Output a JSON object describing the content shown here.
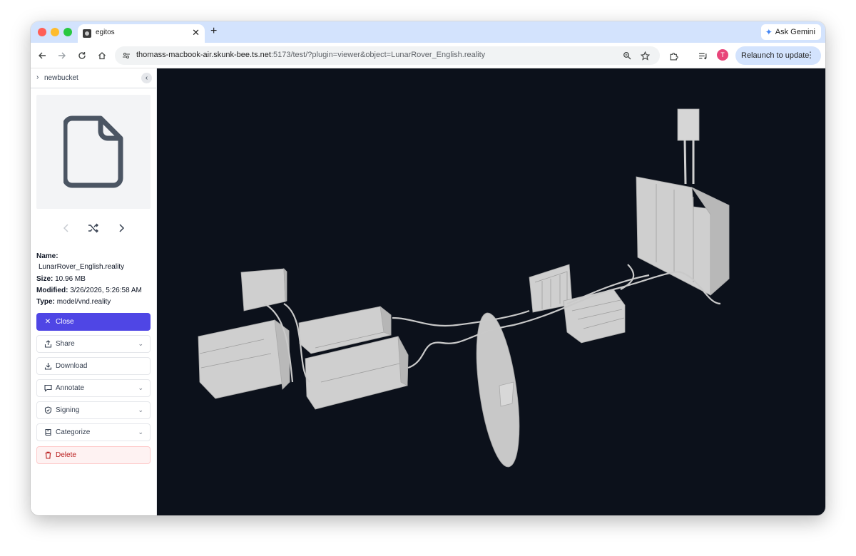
{
  "browser": {
    "tab_title": "egitos",
    "tab_close": "✕",
    "new_tab": "+",
    "gemini_label": "Ask Gemini",
    "url_host": "thomass-macbook-air.skunk-bee.ts.net",
    "url_path": ":5173/test/?plugin=viewer&object=LunarRover_English.reality",
    "avatar_initial": "T",
    "relaunch_label": "Relaunch to update"
  },
  "sidebar": {
    "breadcrumb": "newbucket",
    "name_label": "Name:",
    "name_value": "LunarRover_English.reality",
    "size_label": "Size:",
    "size_value": "10.96 MB",
    "modified_label": "Modified:",
    "modified_value": "3/26/2026, 5:26:58 AM",
    "type_label": "Type:",
    "type_value": "model/vnd.reality",
    "buttons": {
      "close": "Close",
      "share": "Share",
      "download": "Download",
      "annotate": "Annotate",
      "signing": "Signing",
      "categorize": "Categorize",
      "delete": "Delete"
    }
  },
  "colors": {
    "tabstrip": "#d3e3fd",
    "primary": "#4f46e5",
    "danger": "#b91c1c",
    "viewer_bg": "#0c111b",
    "model_gray": "#cfcfcf"
  },
  "icons": {
    "file": "file-icon",
    "shuffle": "shuffle-icon",
    "prev": "chevron-left-icon",
    "next": "chevron-right-icon"
  }
}
